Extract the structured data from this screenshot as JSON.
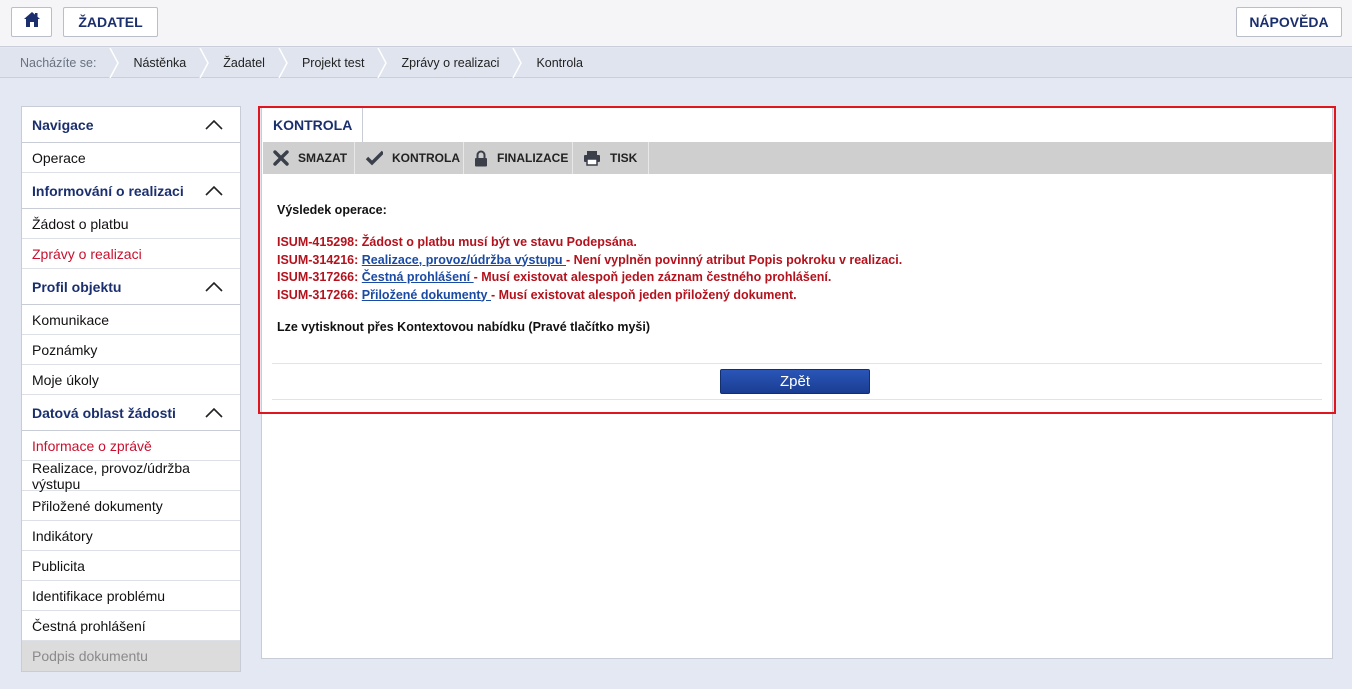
{
  "header": {
    "home_icon": "home-icon",
    "role_label": "ŽADATEL",
    "help_label": "NÁPOVĚDA"
  },
  "breadcrumb": {
    "prefix": "Nacházíte se:",
    "items": [
      "Nástěnka",
      "Žadatel",
      "Projekt test",
      "Zprávy o realizaci",
      "Kontrola"
    ]
  },
  "sidebar": {
    "navigation": {
      "title": "Navigace",
      "items": [
        "Operace"
      ]
    },
    "info": {
      "title": "Informování o realizaci",
      "items": [
        "Žádost o platbu",
        "Zprávy o realizaci"
      ]
    },
    "profile": {
      "title": "Profil objektu",
      "items": [
        "Komunikace",
        "Poznámky",
        "Moje úkoly"
      ]
    },
    "data": {
      "title": "Datová oblast žádosti",
      "items": [
        "Informace o zprávě",
        "Realizace, provoz/údržba výstupu",
        "Přiložené dokumenty",
        "Indikátory",
        "Publicita",
        "Identifikace problému",
        "Čestná prohlášení",
        "Podpis dokumentu"
      ]
    }
  },
  "main": {
    "tab_label": "KONTROLA",
    "toolbar": {
      "delete_label": "SMAZAT",
      "check_label": "KONTROLA",
      "finalize_label": "FINALIZACE",
      "print_label": "TISK"
    },
    "result_title": "Výsledek operace:",
    "errors": [
      {
        "code": "ISUM-415298:",
        "link": "",
        "text": "Žádost o platbu musí být ve stavu Podepsána."
      },
      {
        "code": "ISUM-314216:",
        "link": "Realizace, provoz/údržba výstupu ",
        "text": "- Není vyplněn povinný atribut Popis pokroku v realizaci."
      },
      {
        "code": "ISUM-317266:",
        "link": "Čestná prohlášení ",
        "text": "- Musí existovat alespoň jeden záznam čestného prohlášení."
      },
      {
        "code": "ISUM-317266:",
        "link": "Přiložené dokumenty ",
        "text": "- Musí existovat alespoň jeden přiložený dokument."
      }
    ],
    "print_note": "Lze vytisknout přes Kontextovou nabídku (Pravé tlačítko myši)",
    "back_label": "Zpět"
  },
  "colors": {
    "brand_blue": "#1b2f6e",
    "error_red": "#b3121d",
    "active_red": "#c8102e",
    "highlight_red": "#e0161f"
  }
}
